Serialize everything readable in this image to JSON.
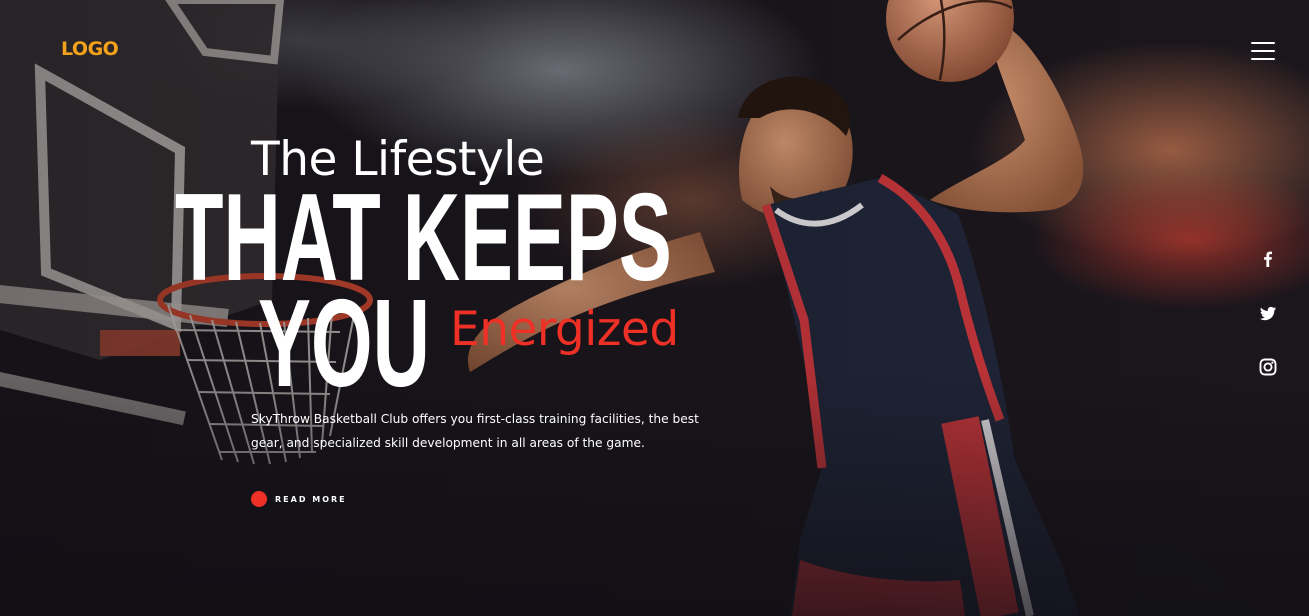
{
  "header": {
    "logo_text": "LOGO"
  },
  "hero": {
    "subtitle": "The Lifestyle",
    "headline_line1": "THAT KEEPS",
    "headline_line2": "YOU",
    "accent_word": "Energized",
    "description": "SkyThrow Basketball Club offers you first-class training facilities, the best gear, and specialized skill development in all areas of the game.",
    "cta_label": "READ MORE"
  },
  "social": [
    {
      "icon": "facebook-icon"
    },
    {
      "icon": "twitter-icon"
    },
    {
      "icon": "instagram-icon"
    }
  ],
  "colors": {
    "logo": "#f4a21b",
    "accent": "#ee3026",
    "text": "#ffffff",
    "background": "#141218"
  }
}
